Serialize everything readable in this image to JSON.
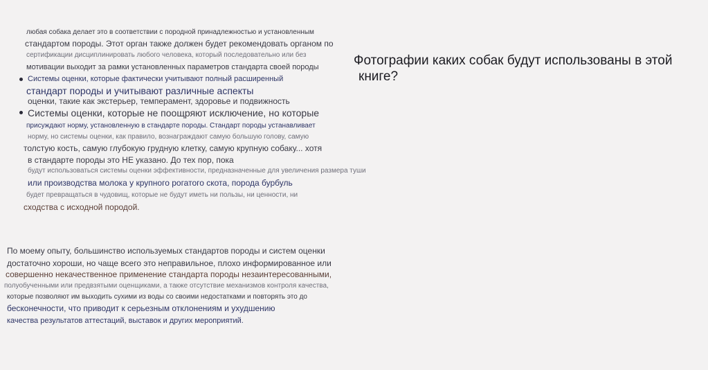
{
  "left_column": {
    "paragraph_1": [
      "любая собака делает это в соответствии с породной принадлежностью и установленным",
      "стандартом породы. Этот орган также должен будет рекомендовать органом по",
      "сертификации дисциплинировать любого человека, который последовательно или без",
      "мотивации выходит за рамки установленных параметров стандарта своей породы"
    ],
    "bullet_1": [
      "Системы оценки, которые фактически учитывают полный расширенный",
      "стандарт породы и учитывают различные аспекты",
      "оценки, такие как экстерьер, темперамент, здоровье и подвижность"
    ],
    "bullet_2": [
      "Системы оценки, которые не поощряют исключение, но которые",
      "присуждают норму, установленную в стандарте породы. Стандарт породы устанавливает",
      "норму, но системы оценки, как правило, вознаграждают самую большую голову, самую",
      "толстую кость, самую глубокую грудную клетку, самую крупную собаку... хотя",
      "в стандарте породы это НЕ указано. До тех пор, пока",
      "будут использоваться системы оценки эффективности, предназначенные для увеличения размера туши",
      "или производства молока у крупного рогатого скота, порода бурбуль",
      "будет превращаться в чудовищ, которые не будут иметь ни пользы, ни ценности, ни",
      "сходства с исходной породой."
    ],
    "paragraph_2": [
      "По моему опыту, большинство используемых стандартов породы и систем оценки",
      "достаточно хороши, но чаще всего это неправильное, плохо информированное или",
      "совершенно некачественное применение стандарта породы незаинтересованными,",
      "полуобученными или предвзятыми оценщиками, а также отсутствие механизмов контроля качества,",
      "которые позволяют им выходить сухими из воды со своими недостатками и повторять это до",
      "бесконечности, что приводит к серьезным отклонениям и ухудшению",
      "качества результатов аттестаций, выставок и других мероприятий."
    ]
  },
  "right_column": {
    "question_line_1": "Фотографии каких собак будут использованы в этой",
    "question_line_2": "книге?"
  }
}
